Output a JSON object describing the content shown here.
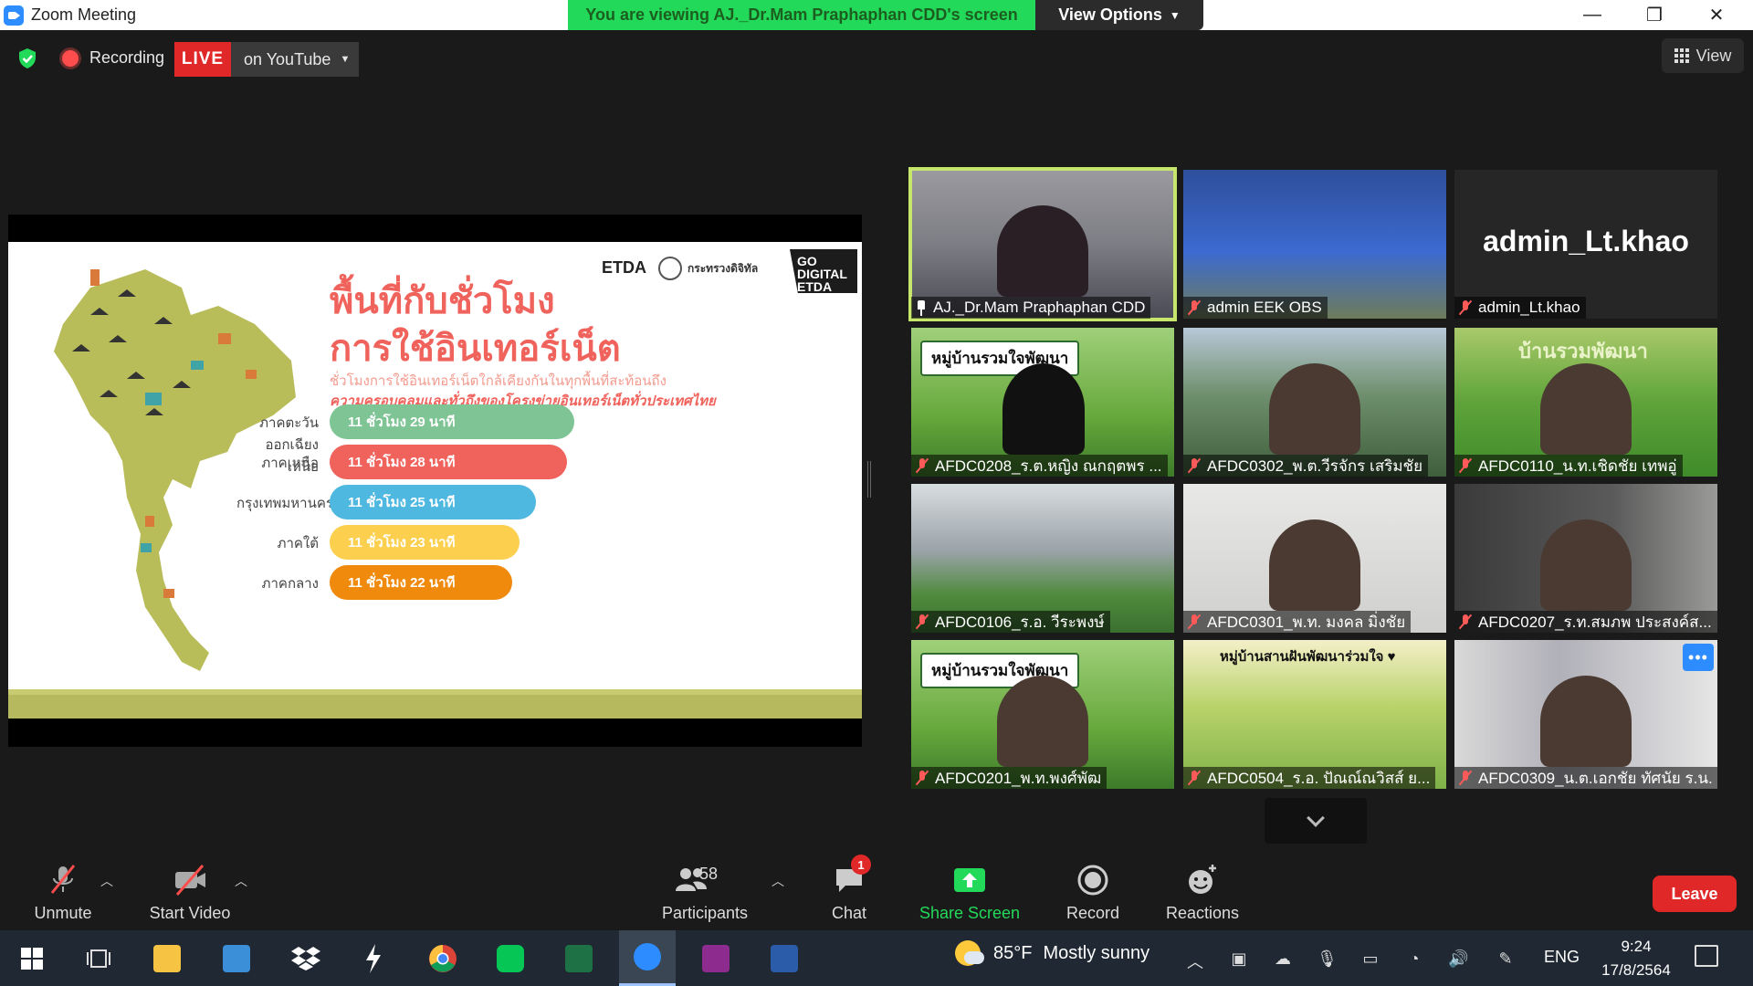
{
  "window": {
    "title": "Zoom Meeting",
    "viewing_banner": "You are viewing AJ._Dr.Mam Praphaphan CDD's screen",
    "view_options": "View Options",
    "minimize": "—",
    "maximize": "❐",
    "close": "✕"
  },
  "status": {
    "recording_label": "Recording",
    "live_label": "LIVE",
    "live_target": "on YouTube",
    "view_label": "View"
  },
  "slide": {
    "heading_line1": "พื้นที่กับชั่วโมง",
    "heading_line2": "การใช้อินเทอร์เน็ต",
    "subtitle1": "ชั่วโมงการใช้อินเทอร์เน็ตใกล้เคียงกันในทุกพื้นที่สะท้อนถึง",
    "subtitle2": "ความครอบคลุมและทั่วถึงของโครงข่ายอินเทอร์เน็ตทั่วประเทศไทย",
    "logo_etda": "ETDA",
    "logo_mdes": "กระทรวงดิจิทัล",
    "logo_go": "GO DIGITAL ETDA",
    "bars": [
      {
        "region": "ภาคตะวันออกเฉียงเหนือ",
        "value": "11 ชั่วโมง 29 นาที",
        "minutes": 689,
        "color": "#7fc494"
      },
      {
        "region": "ภาคเหนือ",
        "value": "11 ชั่วโมง 28 นาที",
        "minutes": 688,
        "color": "#f0635c"
      },
      {
        "region": "กรุงเทพมหานคร",
        "value": "11 ชั่วโมง 25 นาที",
        "minutes": 685,
        "color": "#4fb8e0"
      },
      {
        "region": "ภาคใต้",
        "value": "11 ชั่วโมง 23 นาที",
        "minutes": 683,
        "color": "#fcd04e"
      },
      {
        "region": "ภาคกลาง",
        "value": "11 ชั่วโมง 22 นาที",
        "minutes": 682,
        "color": "#f08a0d"
      }
    ]
  },
  "participants_tiles": [
    {
      "name": "AJ._Dr.Mam Praphaphan CDD",
      "active": true,
      "muted": false,
      "style": "video-woman"
    },
    {
      "name": "admin EEK OBS",
      "active": false,
      "muted": true,
      "style": "banner-blue"
    },
    {
      "name": "admin_Lt.khao",
      "active": false,
      "muted": true,
      "style": "initials"
    },
    {
      "name": "AFDC0208_ร.ต.หญิง ณกฤตพร ...",
      "active": false,
      "muted": true,
      "style": "village-sign",
      "sign": "หมู่บ้านรวมใจพัฒนา"
    },
    {
      "name": "AFDC0302_พ.ต.วีรจักร เสริมชัย",
      "active": false,
      "muted": true,
      "style": "mountains"
    },
    {
      "name": "AFDC0110_น.ท.เชิดชัย เทพอู่",
      "active": false,
      "muted": true,
      "style": "ricefield",
      "sign": "บ้านรวมพัฒนา"
    },
    {
      "name": "AFDC0106_ร.อ. วีระพงษ์",
      "active": false,
      "muted": true,
      "style": "hut"
    },
    {
      "name": "AFDC0301_พ.ท. มงคล มิ่งชัย",
      "active": false,
      "muted": true,
      "style": "office"
    },
    {
      "name": "AFDC0207_ร.ท.สมภพ ประสงค์ส...",
      "active": false,
      "muted": true,
      "style": "dark-uniform"
    },
    {
      "name": "AFDC0201_พ.ท.พงศ์พัฒ",
      "active": false,
      "muted": true,
      "style": "village-sign",
      "sign": "หมู่บ้านรวมใจพัฒนา"
    },
    {
      "name": "AFDC0504_ร.อ. ปัณณ์ณวิสส์ ย...",
      "active": false,
      "muted": true,
      "style": "farm-illustration",
      "sign": "หมู่บ้านสานฝันพัฒนาร่วมใจ ♥"
    },
    {
      "name": "AFDC0309_น.ต.เอกชัย ทัศนัย ร.น.",
      "active": false,
      "muted": true,
      "style": "flag-office",
      "more": "•••"
    }
  ],
  "toolbar": {
    "unmute": "Unmute",
    "start_video": "Start Video",
    "participants": "Participants",
    "participants_count": "58",
    "chat": "Chat",
    "chat_badge": "1",
    "share_screen": "Share Screen",
    "record": "Record",
    "reactions": "Reactions",
    "leave": "Leave"
  },
  "taskbar": {
    "weather_temp": "85°F",
    "weather_text": "Mostly sunny",
    "language": "ENG",
    "time": "9:24",
    "date": "17/8/2564"
  },
  "colors": {
    "zoom_blue": "#2d8cff",
    "banner_green": "#23d959",
    "live_red": "#e02828",
    "active_speaker": "#c6e76b"
  }
}
